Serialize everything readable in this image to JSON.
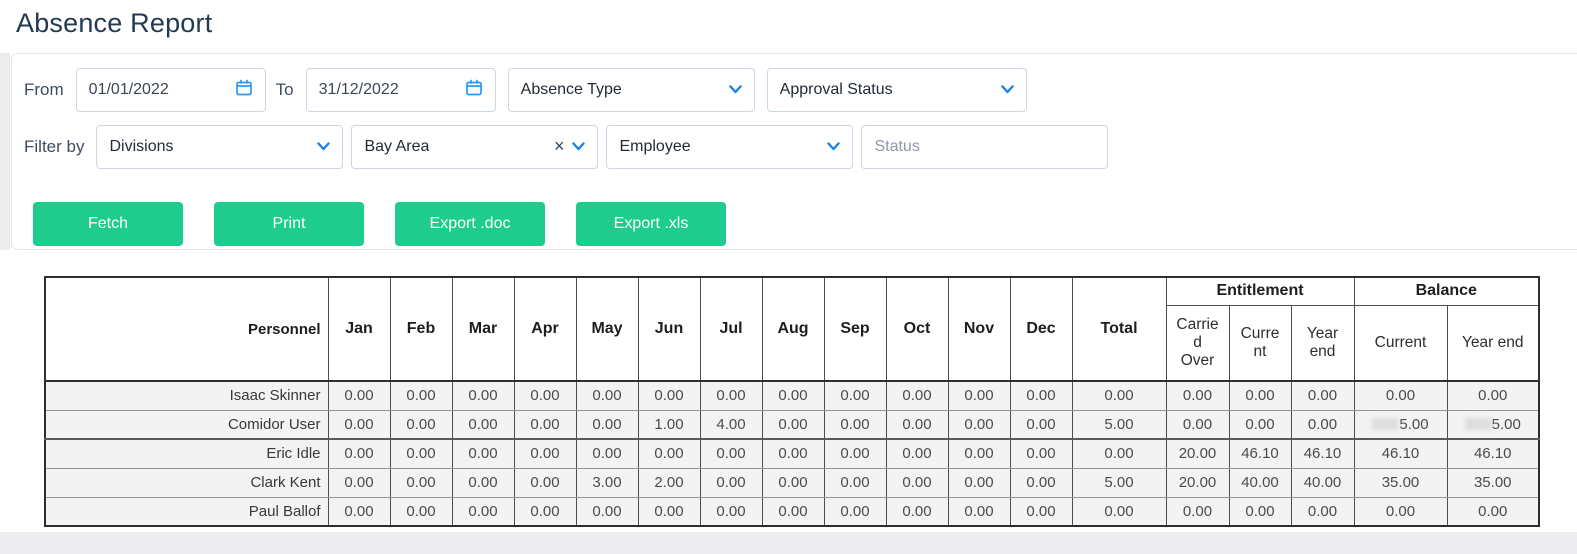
{
  "page": {
    "title": "Absence Report"
  },
  "colors": {
    "accent_green": "#1ecd8e",
    "icon_blue": "#1b83e2",
    "title_navy": "#233a50"
  },
  "filters": {
    "from_label": "From",
    "from_value": "01/01/2022",
    "to_label": "To",
    "to_value": "31/12/2022",
    "absence_type_placeholder": "Absence Type",
    "approval_status_placeholder": "Approval Status",
    "filter_by_label": "Filter by",
    "divisions_placeholder": "Divisions",
    "division_selected": "Bay Area",
    "employee_placeholder": "Employee",
    "status_placeholder": "Status"
  },
  "actions": {
    "fetch": "Fetch",
    "print": "Print",
    "export_doc": "Export .doc",
    "export_xls": "Export .xls"
  },
  "table": {
    "headers": {
      "personnel": "Personnel",
      "total": "Total",
      "entitlement": "Entitlement",
      "balance": "Balance",
      "carried_over": "Carried Over",
      "current": "Current",
      "year_end": "Year end",
      "balance_current": "Current",
      "balance_year_end": "Year end"
    },
    "months": [
      "Jan",
      "Feb",
      "Mar",
      "Apr",
      "May",
      "Jun",
      "Jul",
      "Aug",
      "Sep",
      "Oct",
      "Nov",
      "Dec"
    ],
    "rows": [
      {
        "personnel": "Isaac Skinner",
        "months": [
          "0.00",
          "0.00",
          "0.00",
          "0.00",
          "0.00",
          "0.00",
          "0.00",
          "0.00",
          "0.00",
          "0.00",
          "0.00",
          "0.00"
        ],
        "total": "0.00",
        "ent_carried_over": "0.00",
        "ent_current": "0.00",
        "ent_year_end": "0.00",
        "bal_current": "0.00",
        "bal_year_end": "0.00",
        "bal_redacted": false,
        "thick_top": false
      },
      {
        "personnel": "Comidor User",
        "months": [
          "0.00",
          "0.00",
          "0.00",
          "0.00",
          "0.00",
          "1.00",
          "4.00",
          "0.00",
          "0.00",
          "0.00",
          "0.00",
          "0.00"
        ],
        "total": "5.00",
        "ent_carried_over": "0.00",
        "ent_current": "0.00",
        "ent_year_end": "0.00",
        "bal_current": "5.00",
        "bal_year_end": "5.00",
        "bal_redacted": true,
        "thick_top": false
      },
      {
        "personnel": "Eric Idle",
        "months": [
          "0.00",
          "0.00",
          "0.00",
          "0.00",
          "0.00",
          "0.00",
          "0.00",
          "0.00",
          "0.00",
          "0.00",
          "0.00",
          "0.00"
        ],
        "total": "0.00",
        "ent_carried_over": "20.00",
        "ent_current": "46.10",
        "ent_year_end": "46.10",
        "bal_current": "46.10",
        "bal_year_end": "46.10",
        "bal_redacted": false,
        "thick_top": true
      },
      {
        "personnel": "Clark Kent",
        "months": [
          "0.00",
          "0.00",
          "0.00",
          "0.00",
          "3.00",
          "2.00",
          "0.00",
          "0.00",
          "0.00",
          "0.00",
          "0.00",
          "0.00"
        ],
        "total": "5.00",
        "ent_carried_over": "20.00",
        "ent_current": "40.00",
        "ent_year_end": "40.00",
        "bal_current": "35.00",
        "bal_year_end": "35.00",
        "bal_redacted": false,
        "thick_top": false
      },
      {
        "personnel": "Paul Ballof",
        "months": [
          "0.00",
          "0.00",
          "0.00",
          "0.00",
          "0.00",
          "0.00",
          "0.00",
          "0.00",
          "0.00",
          "0.00",
          "0.00",
          "0.00"
        ],
        "total": "0.00",
        "ent_carried_over": "0.00",
        "ent_current": "0.00",
        "ent_year_end": "0.00",
        "bal_current": "0.00",
        "bal_year_end": "0.00",
        "bal_redacted": false,
        "thick_top": false
      }
    ]
  }
}
